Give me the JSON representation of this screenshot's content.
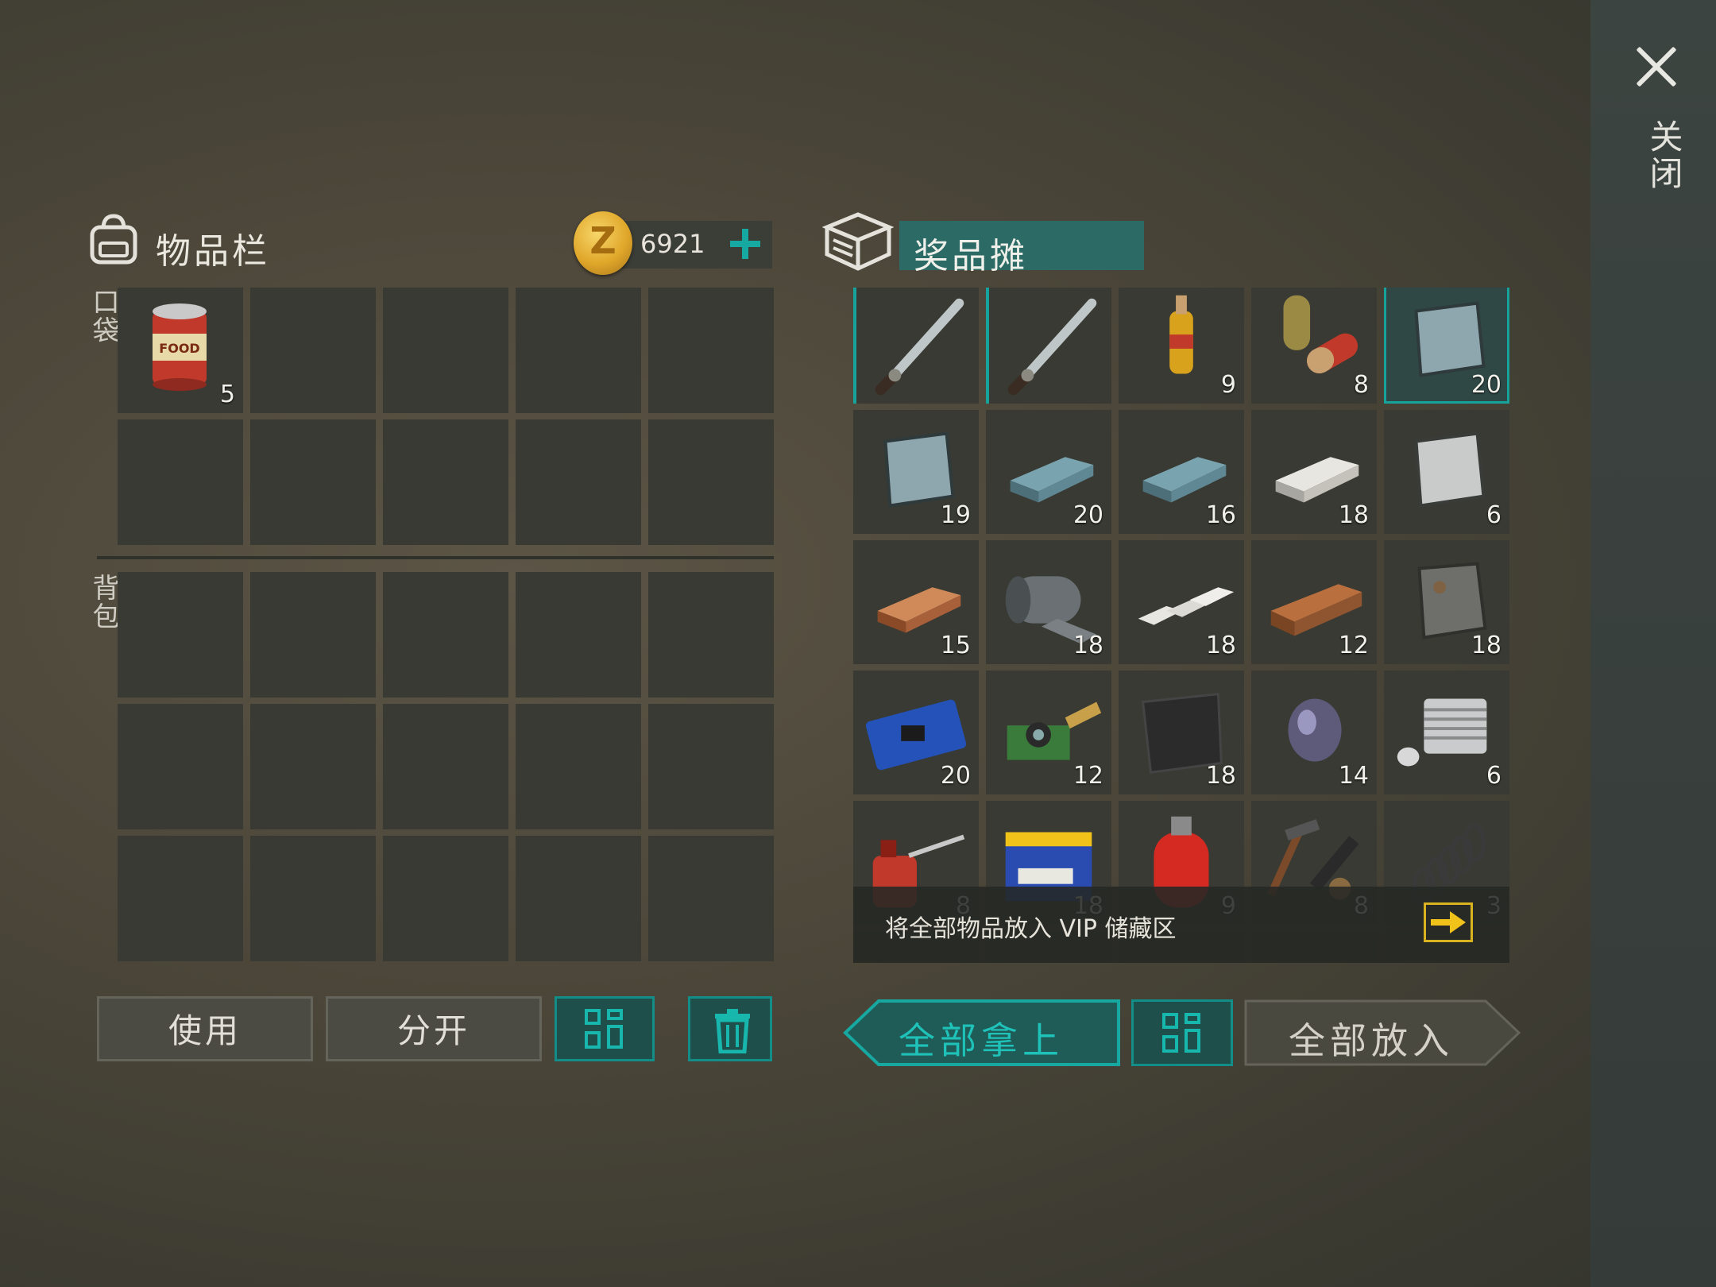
{
  "window": {
    "close_label": "关闭"
  },
  "inventory": {
    "title": "物品栏",
    "coins": "6921",
    "pocket_label": "口袋",
    "backpack_label": "背包",
    "pocket_items": [
      {
        "slot": 0,
        "icon": "canned-food-icon",
        "count": "5"
      }
    ],
    "buttons": {
      "use": "使用",
      "split": "分开"
    }
  },
  "prize_stall": {
    "title": "奖品摊",
    "items": [
      {
        "icon": "machete-icon",
        "count": ""
      },
      {
        "icon": "machete-icon",
        "count": ""
      },
      {
        "icon": "ampoule-icon",
        "count": "9"
      },
      {
        "icon": "pills-icon",
        "count": "8"
      },
      {
        "icon": "steel-plate-icon",
        "count": "20"
      },
      {
        "icon": "steel-plate-icon",
        "count": "19"
      },
      {
        "icon": "steel-ingot-icon",
        "count": "20"
      },
      {
        "icon": "steel-ingot-icon",
        "count": "16"
      },
      {
        "icon": "aluminum-ingot-icon",
        "count": "18"
      },
      {
        "icon": "aluminum-plate-icon",
        "count": "6"
      },
      {
        "icon": "copper-ingot-icon",
        "count": "15"
      },
      {
        "icon": "metal-roll-icon",
        "count": "18"
      },
      {
        "icon": "silver-bars-icon",
        "count": "18"
      },
      {
        "icon": "wood-plank-icon",
        "count": "12"
      },
      {
        "icon": "rusty-plate-icon",
        "count": "18"
      },
      {
        "icon": "circuit-board-icon",
        "count": "20"
      },
      {
        "icon": "camera-module-icon",
        "count": "12"
      },
      {
        "icon": "carbon-fabric-icon",
        "count": "18"
      },
      {
        "icon": "lens-icon",
        "count": "14"
      },
      {
        "icon": "engine-cylinder-icon",
        "count": "6"
      },
      {
        "icon": "oil-can-icon",
        "count": "8"
      },
      {
        "icon": "battery-icon",
        "count": "18"
      },
      {
        "icon": "gas-cylinder-icon",
        "count": "9"
      },
      {
        "icon": "tool-parts-icon",
        "count": "8"
      },
      {
        "icon": "spring-icon",
        "count": "3"
      }
    ],
    "vip_text": "将全部物品放入 VIP 储藏区",
    "buttons": {
      "take_all": "全部拿上",
      "put_all": "全部放入"
    }
  },
  "colors": {
    "accent": "#16a9a2",
    "panel": "#383a33",
    "gold": "#d9b31f"
  }
}
